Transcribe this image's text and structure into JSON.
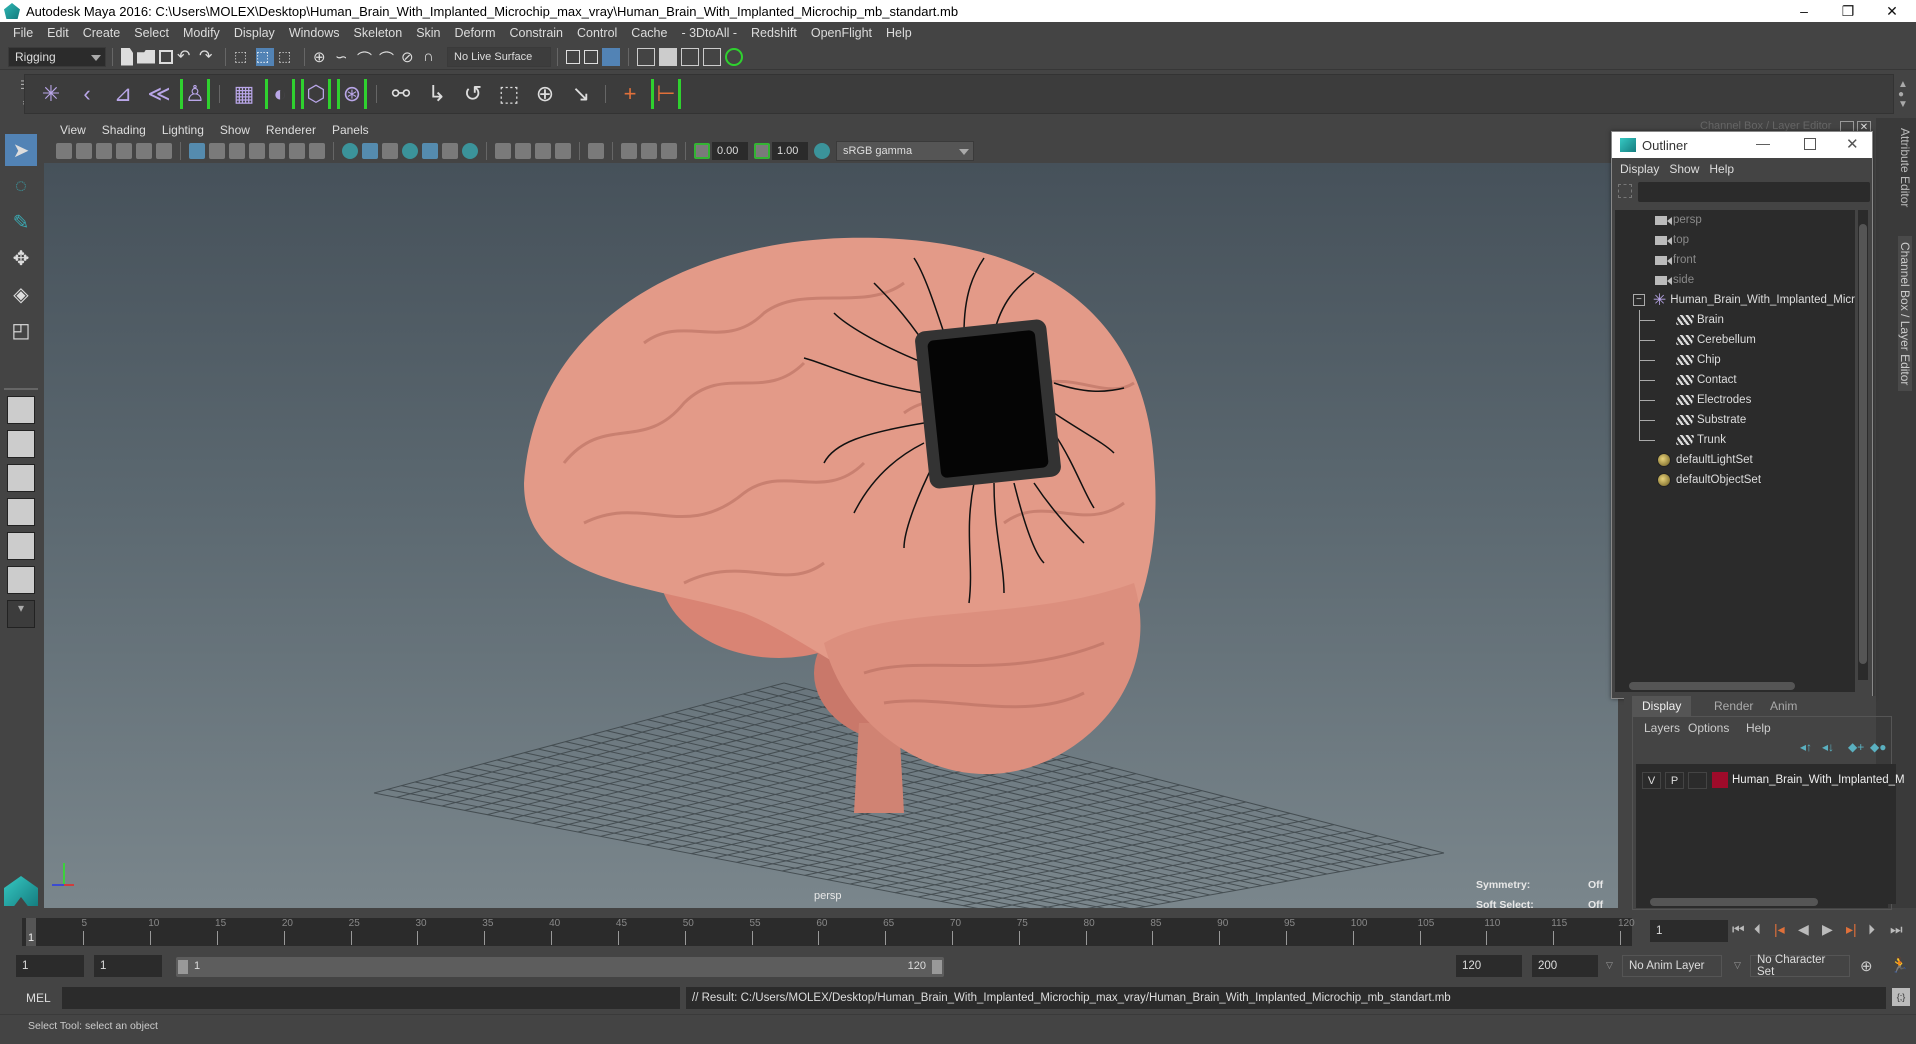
{
  "window": {
    "title": "Autodesk Maya 2016: C:\\Users\\MOLEX\\Desktop\\Human_Brain_With_Implanted_Microchip_max_vray\\Human_Brain_With_Implanted_Microchip_mb_standart.mb",
    "minimize": "–",
    "restore": "❐",
    "close": "✕"
  },
  "menubar": [
    "File",
    "Edit",
    "Create",
    "Select",
    "Modify",
    "Display",
    "Windows",
    "Skeleton",
    "Skin",
    "Deform",
    "Constrain",
    "Control",
    "Cache",
    "- 3DtoAll -",
    "Redshift",
    "OpenFlight",
    "Help"
  ],
  "statusline": {
    "menuset": "Rigging",
    "live_surface": "No Live Surface"
  },
  "panel": {
    "menu": [
      "View",
      "Shading",
      "Lighting",
      "Show",
      "Renderer",
      "Panels"
    ],
    "exposure": "0.00",
    "gamma": "1.00",
    "color_space": "sRGB gamma",
    "camera_label": "persp"
  },
  "hud": {
    "symmetry_label": "Symmetry:",
    "symmetry_value": "Off",
    "soft_select_label": "Soft Select:",
    "soft_select_value": "Off"
  },
  "outliner": {
    "title": "Outliner",
    "menu": [
      "Display",
      "Show",
      "Help"
    ],
    "cameras": [
      "persp",
      "top",
      "front",
      "side"
    ],
    "group": "Human_Brain_With_Implanted_Micr",
    "children": [
      "Brain",
      "Cerebellum",
      "Chip",
      "Contact",
      "Electrodes",
      "Substrate",
      "Trunk"
    ],
    "sets": [
      "defaultLightSet",
      "defaultObjectSet"
    ]
  },
  "side_tabs": {
    "attribute_editor": "Attribute Editor",
    "channel_box": "Channel Box / Layer Editor",
    "channel_box_header": "Channel Box / Layer Editor"
  },
  "layer_editor": {
    "tabs": [
      "Display",
      "Render",
      "Anim"
    ],
    "active_tab": "Display",
    "menu": [
      "Layers",
      "Options",
      "Help"
    ],
    "layers": [
      {
        "visible": "V",
        "playback": "P",
        "name": "Human_Brain_With_Implanted_M",
        "color": "#9e0b2a"
      }
    ]
  },
  "timeline": {
    "ticks": [
      "5",
      "10",
      "15",
      "20",
      "25",
      "30",
      "35",
      "40",
      "45",
      "50",
      "55",
      "60",
      "65",
      "70",
      "75",
      "80",
      "85",
      "90",
      "95",
      "100",
      "105",
      "110",
      "115",
      "120"
    ],
    "current_marker": "1",
    "current_frame": "1"
  },
  "range": {
    "start": "1",
    "playback_start": "1",
    "slider_start": "1",
    "slider_end": "120",
    "playback_end": "120",
    "end": "200",
    "anim_layer": "No Anim Layer",
    "character_set": "No Character Set"
  },
  "command": {
    "lang": "MEL",
    "input": "",
    "result": "// Result: C:/Users/MOLEX/Desktop/Human_Brain_With_Implanted_Microchip_max_vray/Human_Brain_With_Implanted_Microchip_mb_standart.mb"
  },
  "helpline": "Select Tool: select an object",
  "colors": {
    "accent_blue": "#5283b5",
    "maya_teal": "#2fb9b5",
    "brain": "#e0917f",
    "bracket_green": "#2fd12f"
  }
}
